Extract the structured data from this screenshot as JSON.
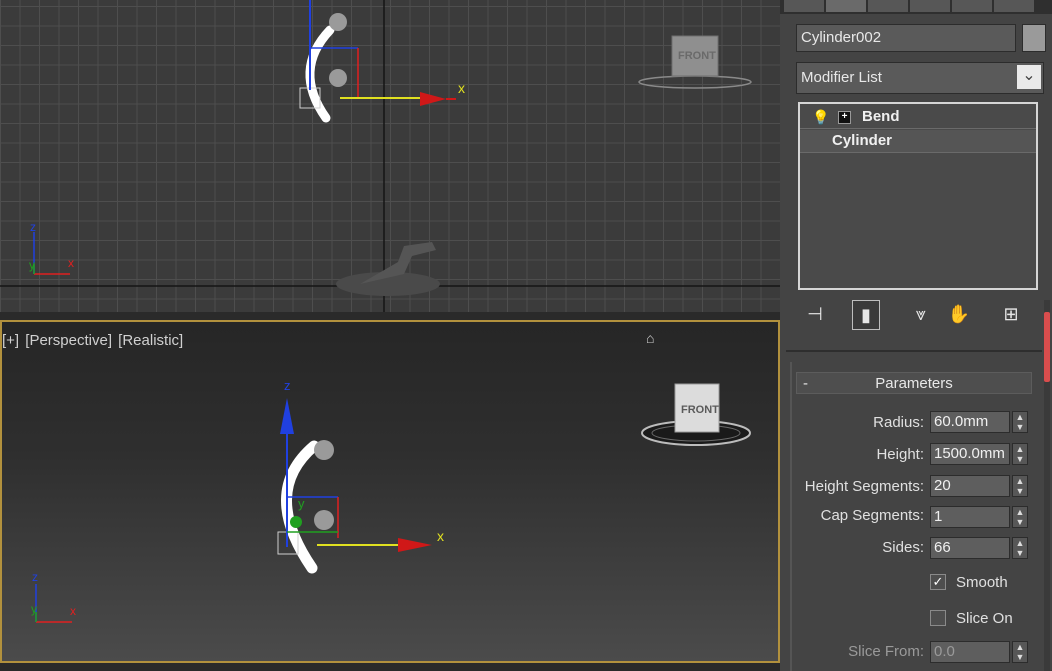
{
  "viewport_top": {
    "axis_x": "x",
    "gizmo_x": "x",
    "gizmo_y": "y",
    "gizmo_z": "z",
    "viewcube_label": "FRONT"
  },
  "viewport_bottom": {
    "label_plus": "[+]",
    "label_view": "[Perspective]",
    "label_shading": "[Realistic]",
    "axis_x": "x",
    "axis_y": "y",
    "axis_z": "z",
    "gizmo_x": "x",
    "gizmo_y": "y",
    "gizmo_z": "z",
    "viewcube_label": "FRONT"
  },
  "panel": {
    "object_name": "Cylinder002",
    "object_color": "#9a9a9a",
    "modifier_list": "Modifier List",
    "stack": [
      {
        "label": "Bend"
      },
      {
        "label": "Cylinder"
      }
    ],
    "rollout_toggle": "-",
    "rollout_title": "Parameters",
    "params": [
      {
        "label": "Radius:",
        "value": "60.0mm"
      },
      {
        "label": "Height:",
        "value": "1500.0mm"
      },
      {
        "label": "Height Segments:",
        "value": "20"
      },
      {
        "label": "Cap Segments:",
        "value": "1"
      },
      {
        "label": "Sides:",
        "value": "66"
      }
    ],
    "checkboxes": [
      {
        "label": "Smooth",
        "checked": true
      },
      {
        "label": "Slice On",
        "checked": false
      }
    ],
    "slice_from": {
      "label": "Slice From:",
      "value": "0.0"
    }
  },
  "colors": {
    "active_border": "#b2913d",
    "gizmo_x": "#e02020",
    "gizmo_y": "#20a020",
    "gizmo_z": "#2040e0",
    "axis_yellow": "#e0e020"
  }
}
